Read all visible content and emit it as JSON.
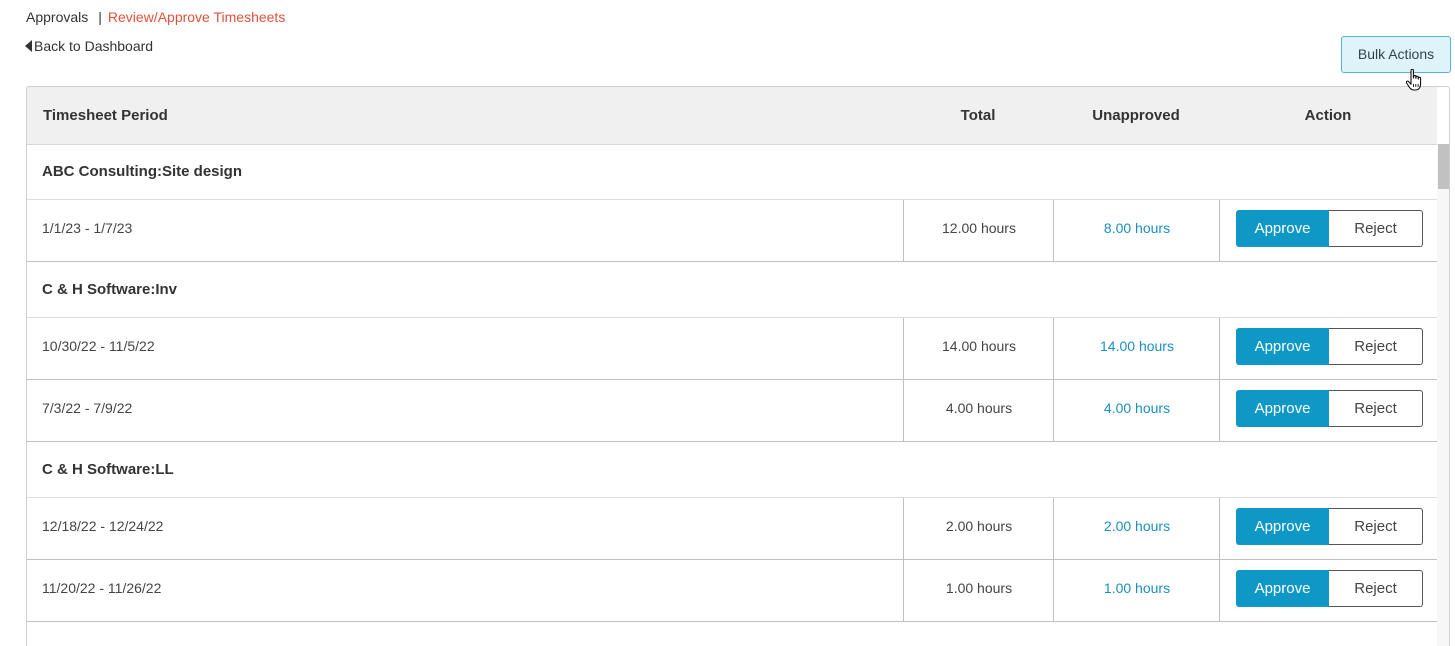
{
  "breadcrumb": {
    "root": "Approvals",
    "separator": "|",
    "current": "Review/Approve Timesheets"
  },
  "back_link": "Back to Dashboard",
  "bulk_actions_label": "Bulk Actions",
  "table": {
    "headers": {
      "period": "Timesheet Period",
      "total": "Total",
      "unapproved": "Unapproved",
      "action": "Action"
    },
    "groups": [
      {
        "name": "ABC Consulting:Site design",
        "rows": [
          {
            "period": "1/1/23 - 1/7/23",
            "total": "12.00 hours",
            "unapproved": "8.00 hours"
          }
        ]
      },
      {
        "name": "C & H Software:Inv",
        "rows": [
          {
            "period": "10/30/22 - 11/5/22",
            "total": "14.00 hours",
            "unapproved": "14.00 hours"
          },
          {
            "period": "7/3/22 - 7/9/22",
            "total": "4.00 hours",
            "unapproved": "4.00 hours"
          }
        ]
      },
      {
        "name": "C & H Software:LL",
        "rows": [
          {
            "period": "12/18/22 - 12/24/22",
            "total": "2.00 hours",
            "unapproved": "2.00 hours"
          },
          {
            "period": "11/20/22 - 11/26/22",
            "total": "1.00 hours",
            "unapproved": "1.00 hours"
          }
        ]
      }
    ],
    "approve_label": "Approve",
    "reject_label": "Reject"
  },
  "colors": {
    "accent": "#0f98c6",
    "link": "#1b8fbf",
    "breadcrumb_current": "#e0523a",
    "bulk_bg": "#dff3fa"
  },
  "icons": {
    "back": "caret-left-icon",
    "cursor": "hand-pointer-icon"
  }
}
